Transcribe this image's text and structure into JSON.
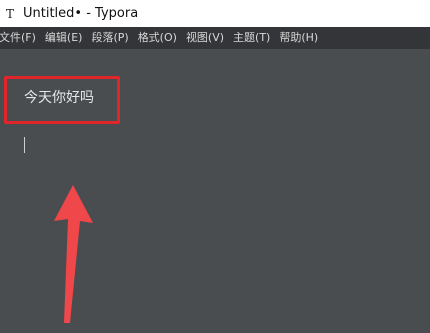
{
  "window": {
    "app_icon_glyph": "T",
    "title": "Untitled• - Typora"
  },
  "menubar": {
    "items": [
      "文件(F)",
      "编辑(E)",
      "段落(P)",
      "格式(O)",
      "视图(V)",
      "主题(T)",
      "帮助(H)"
    ]
  },
  "editor": {
    "content": "今天你好吗"
  },
  "annotations": {
    "highlight_color": "#e0262b",
    "arrow_color": "#f0474b"
  }
}
